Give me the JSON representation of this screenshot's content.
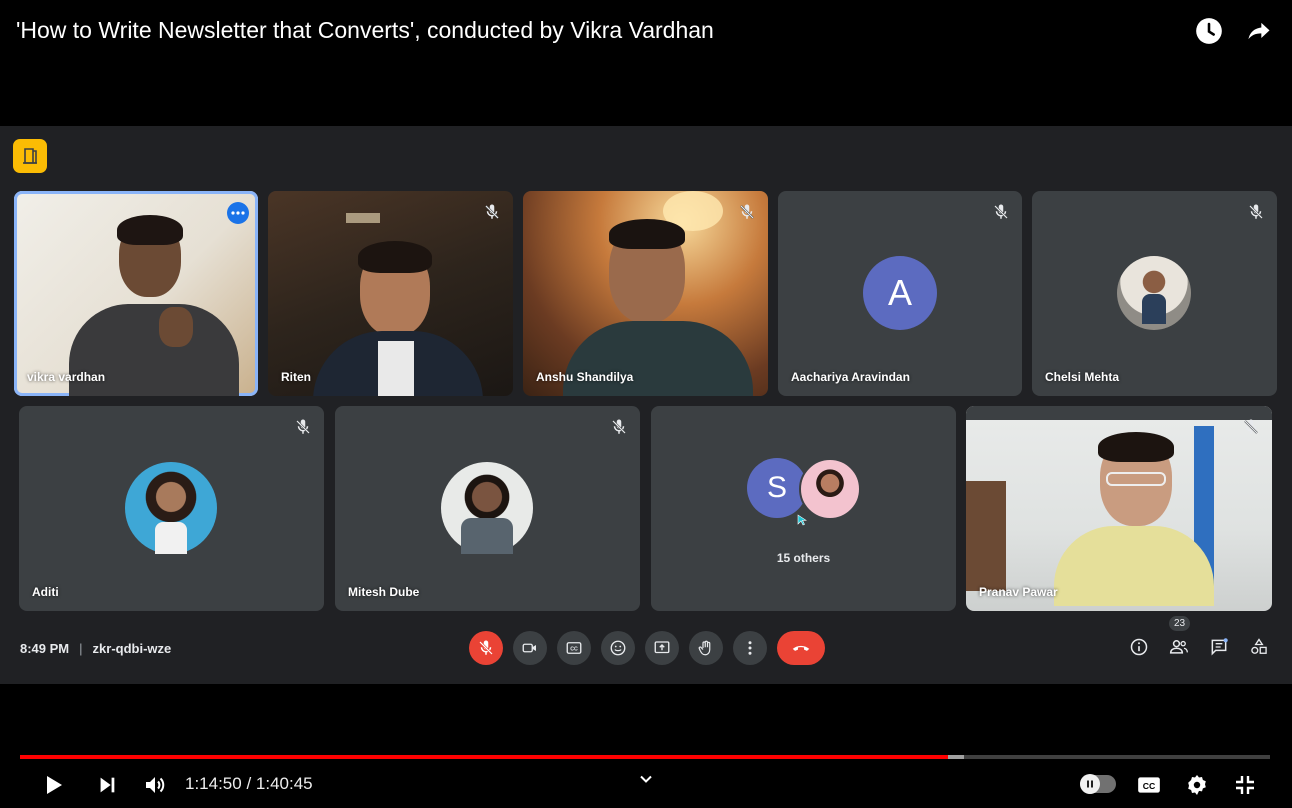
{
  "video": {
    "title": "'How to Write Newsletter that Converts', conducted by Vikra Vardhan"
  },
  "top_actions": [
    "clock-icon",
    "share-icon"
  ],
  "meet": {
    "time": "8:49 PM",
    "meeting_code": "zkr-qdbi-wze",
    "participants_count": "23",
    "participants": [
      {
        "name": "vikra vardhan",
        "type": "video",
        "active": true
      },
      {
        "name": "Riten",
        "type": "video"
      },
      {
        "name": "Anshu Shandilya",
        "type": "video"
      },
      {
        "name": "Aachariya Aravindan",
        "type": "initial",
        "initial": "A",
        "color": "#5c6bc0"
      },
      {
        "name": "Chelsi Mehta",
        "type": "photo"
      },
      {
        "name": "Aditi",
        "type": "photo"
      },
      {
        "name": "Mitesh Dube",
        "type": "photo"
      },
      {
        "name": "15 others",
        "type": "group",
        "initial": "S",
        "color": "#5c6bc0"
      },
      {
        "name": "Pranav Pawar",
        "type": "video"
      }
    ],
    "colors": {
      "end_call": "#ea4335",
      "active_outline": "#8ab4f8",
      "badge": "#fbbc04"
    }
  },
  "player": {
    "time_display": "1:14:50 / 1:40:45",
    "played_fraction": 0.7427,
    "buffered_fraction": 0.7551,
    "progress_color": "#ff0000"
  }
}
